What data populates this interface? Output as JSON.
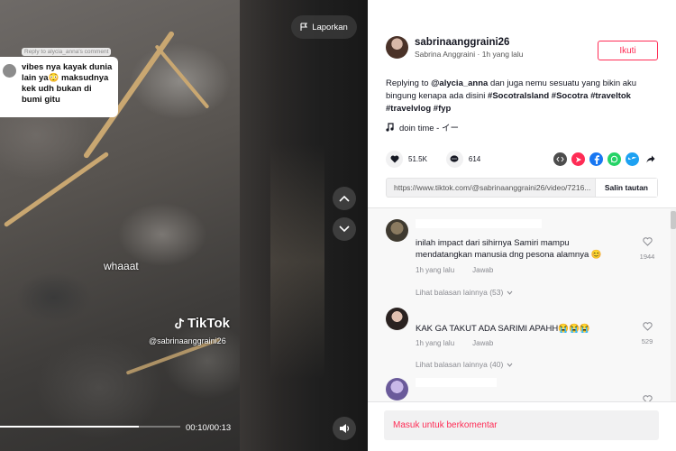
{
  "video": {
    "report_label": "Laporkan",
    "reply_card": {
      "label": "Reply to alycia_anna's comment",
      "text": "vibes nya kayak dunia lain ya😳 maksudnya kek udh bukan di bumi gitu"
    },
    "caption_overlay": "whaaat",
    "watermark_brand": "TikTok",
    "watermark_handle": "@sabrinaanggraini26",
    "time": "00:10/00:13",
    "progress": 0.77
  },
  "author": {
    "username": "sabrinaanggraini26",
    "display_name": "Sabrina Anggraini",
    "posted": "1h yang lalu",
    "follow_label": "Ikuti"
  },
  "description": {
    "prefix": "Replying to ",
    "mention": "@alycia_anna",
    "body": " dan juga nemu sesuatu yang bikin aku bingung kenapa ada disini ",
    "hashtags": "#SocotraIsland #Socotra #traveltok #travelvlog #fyp"
  },
  "music": "doin time - イー",
  "stats": {
    "likes": "51.5K",
    "comments": "614"
  },
  "share_icons": [
    "embed-icon",
    "send-icon",
    "facebook-icon",
    "whatsapp-icon",
    "twitter-icon",
    "share-arrow-icon"
  ],
  "link": {
    "url": "https://www.tiktok.com/@sabrinaanggraini26/video/7216...",
    "copy_label": "Salin tautan"
  },
  "comments": [
    {
      "text": "inilah impact dari sihirnya Samiri mampu mendatangkan manusia dng pesona alamnya 😊",
      "time": "1h yang lalu",
      "reply": "Jawab",
      "likes": "1944",
      "more": "Lihat balasan lainnya (53)"
    },
    {
      "text": "KAK GA TAKUT ADA SARIMI APAHH😭😭😭",
      "time": "1h yang lalu",
      "reply": "Jawab",
      "likes": "529",
      "more": "Lihat balasan lainnya (40)"
    }
  ],
  "comment_bar": {
    "label": "Masuk untuk berkomentar"
  },
  "colors": {
    "accent": "#fe2c55",
    "facebook": "#1877f2",
    "whatsapp": "#25d366",
    "twitter": "#1da1f2"
  }
}
